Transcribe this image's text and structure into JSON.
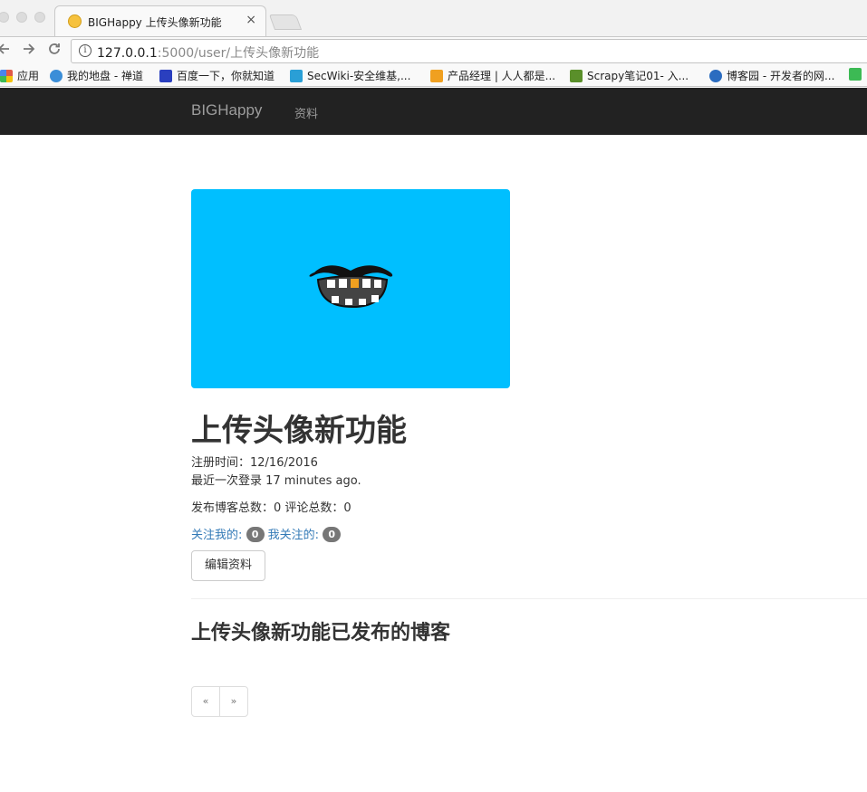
{
  "browser": {
    "tab_title": "BIGHappy 上传头像新功能",
    "tab_close": "×",
    "url_host": "127.0.0.1",
    "url_rest": ":5000/user/上传头像新功能",
    "bookmarks": [
      {
        "label": "应用",
        "icon": "apps-grid-icon",
        "color": "#e05a47"
      },
      {
        "label": "我的地盘 - 禅道",
        "icon": "globe-icon",
        "color": "#3b8ed8"
      },
      {
        "label": "百度一下，你就知道",
        "icon": "baidu-paw-icon",
        "color": "#2a3fbf"
      },
      {
        "label": "SecWiki-安全维基,...",
        "icon": "secwiki-icon",
        "color": "#2a9fd6"
      },
      {
        "label": "产品经理 | 人人都是...",
        "icon": "woshipm-icon",
        "color": "#f0a020"
      },
      {
        "label": "Scrapy笔记01- 入...",
        "icon": "book-icon",
        "color": "#5a8f2a"
      },
      {
        "label": "博客园 - 开发者的网...",
        "icon": "cnblogs-icon",
        "color": "#2b6cc0"
      }
    ]
  },
  "navbar": {
    "brand": "BIGHappy",
    "link_profile": "资料"
  },
  "profile": {
    "avatar_bg": "#00bfff",
    "name": "上传头像新功能",
    "registered": "注册时间：12/16/2016",
    "last_seen": "最近一次登录 17 minutes ago.",
    "counts": "发布博客总数：0 评论总数：0",
    "followers_label": "关注我的:",
    "followers_count": "0",
    "following_label": "我关注的:",
    "following_count": "0",
    "edit_button": "编辑资料",
    "posts_heading": "上传头像新功能已发布的博客"
  },
  "pagination": {
    "prev": "«",
    "next": "»"
  }
}
